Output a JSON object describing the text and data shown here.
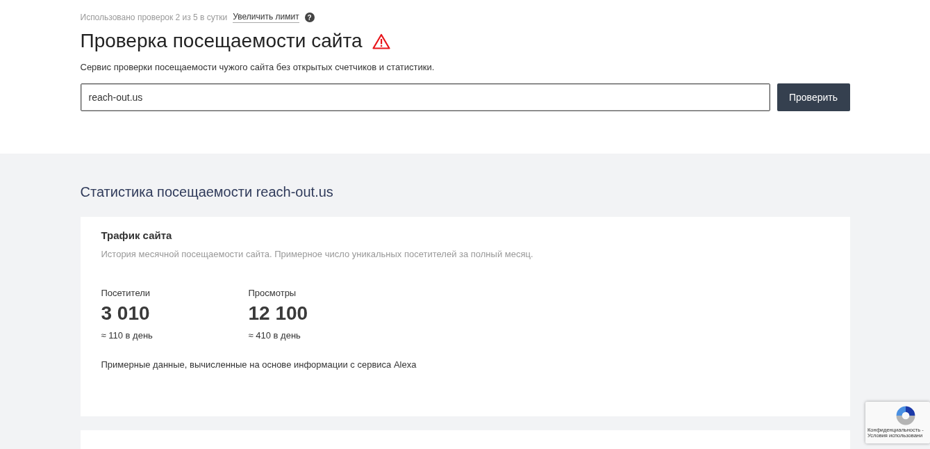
{
  "usage": {
    "text": "Использовано проверок 2 из 5 в сутки",
    "link": "Увеличить лимит",
    "help": "?"
  },
  "title": "Проверка посещаемости сайта",
  "description": "Сервис проверки посещаемости чужого сайта без открытых счетчиков и статистики.",
  "search": {
    "value": "reach-out.us",
    "button": "Проверить"
  },
  "stats_heading": "Статистика посещаемости reach-out.us",
  "traffic_card": {
    "title": "Трафик сайта",
    "subtitle": "История месячной посещаемости сайта. Примерное число уникальных посетителей за полный месяц.",
    "metrics": [
      {
        "label": "Посетители",
        "value": "3 010",
        "per_day": "≈ 110 в день"
      },
      {
        "label": "Просмотры",
        "value": "12 100",
        "per_day": "≈ 410 в день"
      }
    ],
    "note": "Примерные данные, вычисленные на основе информации с сервиса Alexa"
  },
  "recaptcha": {
    "lines": [
      "Конфиденциальность -",
      "Условия использовани"
    ]
  }
}
